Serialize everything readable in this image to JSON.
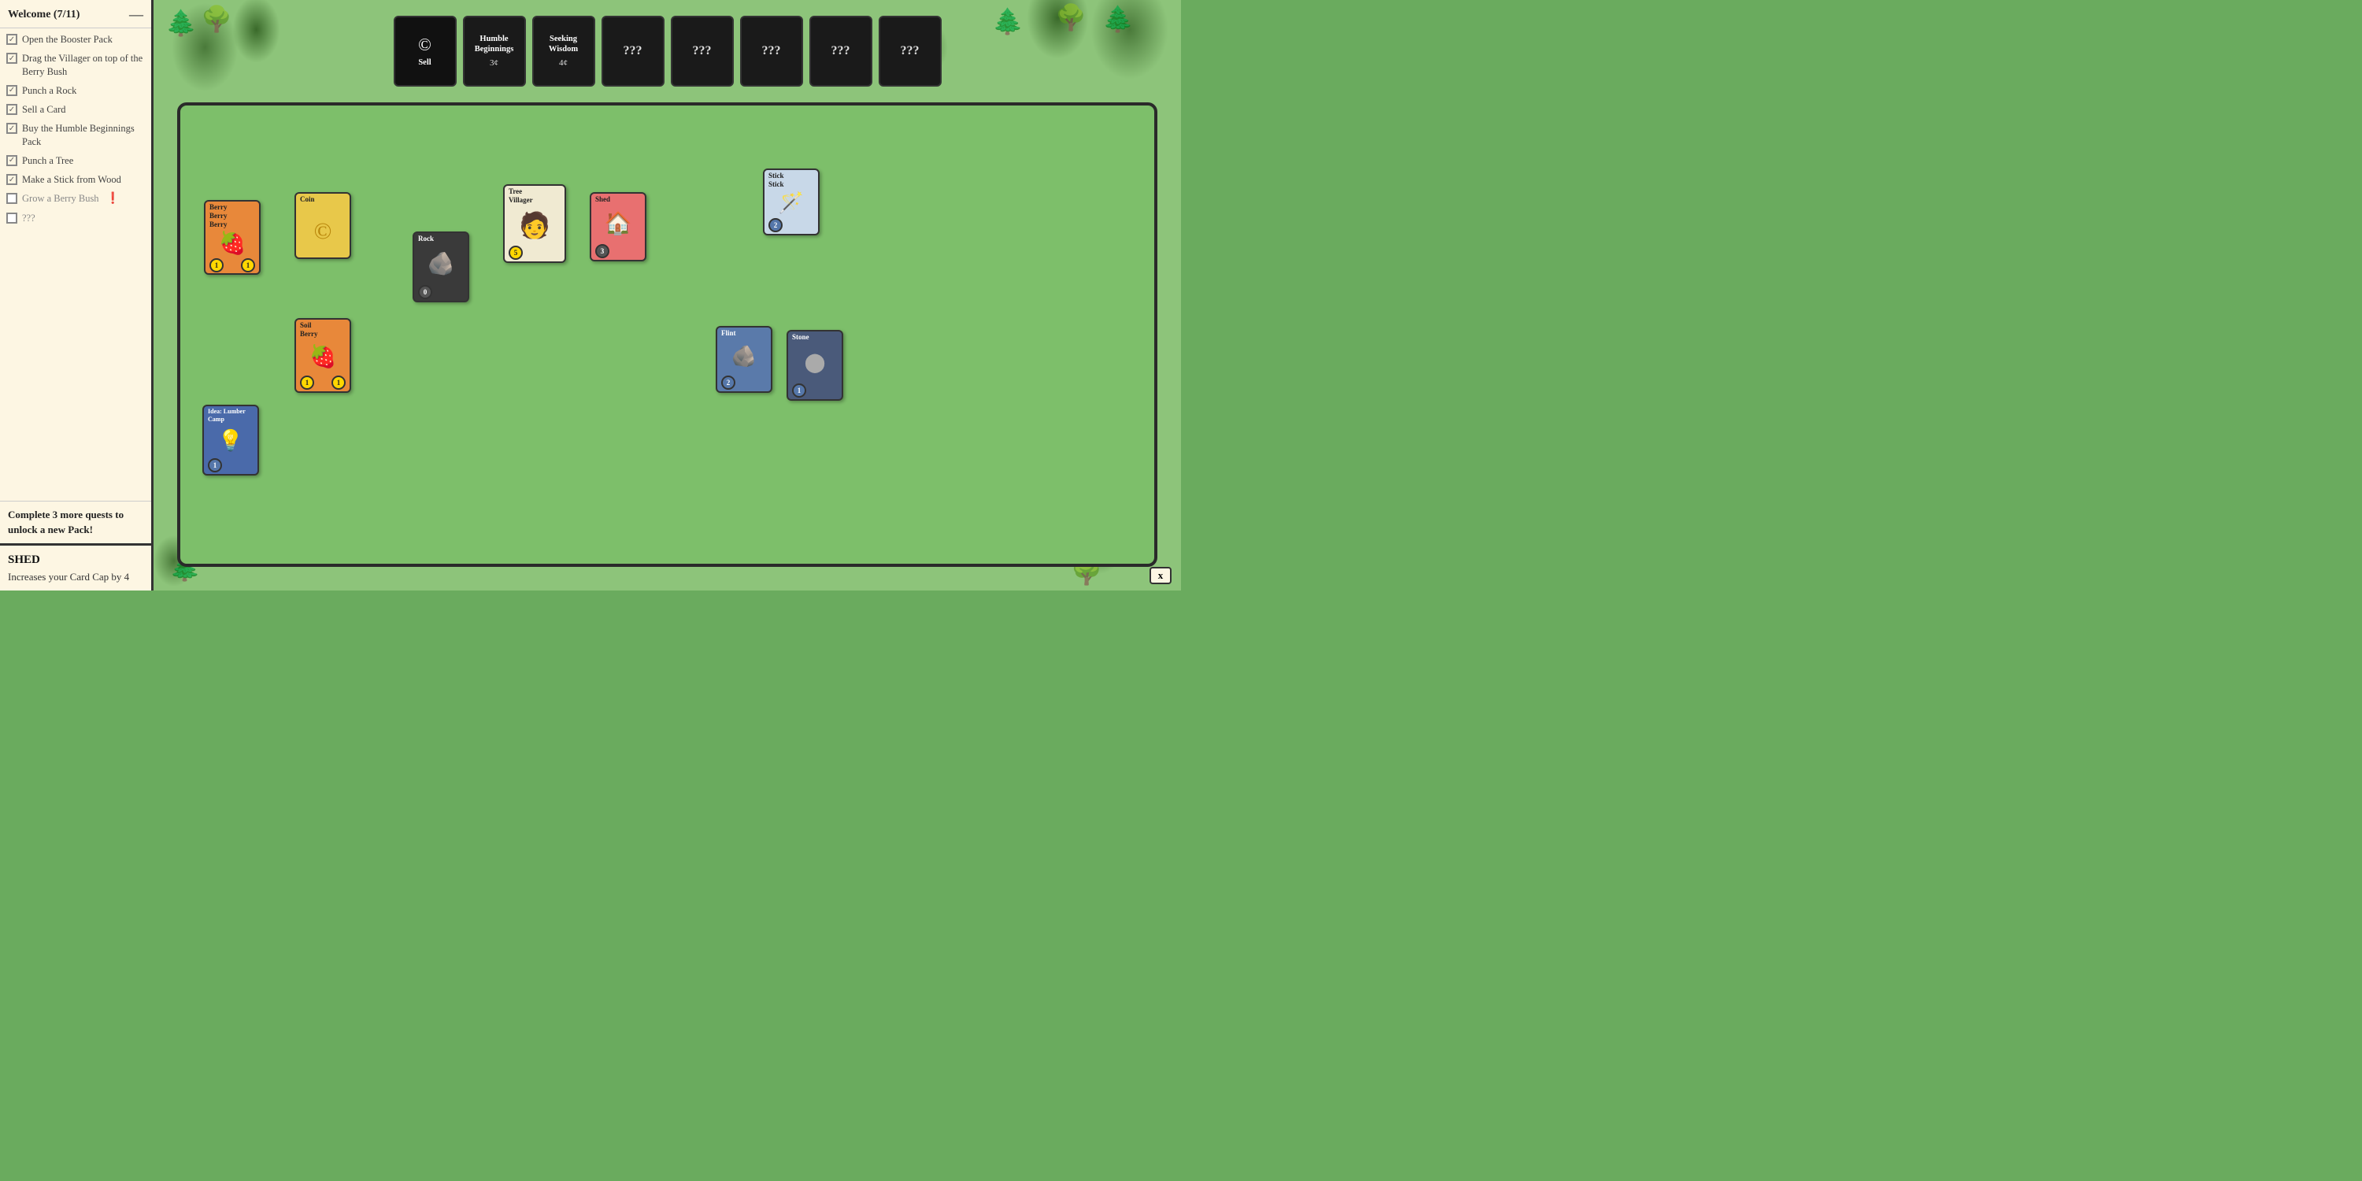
{
  "leftPanel": {
    "title": "Welcome (7/11)",
    "minimizeIcon": "—",
    "quests": [
      {
        "id": "open-booster",
        "label": "Open the Booster Pack",
        "completed": true
      },
      {
        "id": "drag-villager",
        "label": "Drag the Villager on top of the Berry Bush",
        "completed": true
      },
      {
        "id": "punch-rock",
        "label": "Punch a Rock",
        "completed": true
      },
      {
        "id": "sell-card",
        "label": "Sell a Card",
        "completed": true
      },
      {
        "id": "buy-humble",
        "label": "Buy the Humble Beginnings Pack",
        "completed": true
      },
      {
        "id": "punch-tree",
        "label": "Punch a Tree",
        "completed": true
      },
      {
        "id": "make-stick",
        "label": "Make a Stick from Wood",
        "completed": true
      },
      {
        "id": "grow-berry",
        "label": "Grow a Berry Bush",
        "completed": false,
        "alert": true
      },
      {
        "id": "unknown",
        "label": "???",
        "completed": false
      }
    ],
    "unlockText": "Complete 3 more quests to unlock a new Pack!",
    "shedInfo": {
      "title": "SHED",
      "description": "Increases your Card Cap by 4"
    }
  },
  "shopRow": {
    "sellCard": {
      "icon": "©",
      "label": "Sell"
    },
    "packs": [
      {
        "id": "humble",
        "name": "Humble Beginnings",
        "cost": "3"
      },
      {
        "id": "seeking",
        "name": "Seeking Wisdom",
        "cost": "4"
      },
      {
        "id": "unknown1",
        "name": "???",
        "cost": ""
      },
      {
        "id": "unknown2",
        "name": "???",
        "cost": ""
      },
      {
        "id": "unknown3",
        "name": "???",
        "cost": ""
      },
      {
        "id": "unknown4",
        "name": "???",
        "cost": ""
      },
      {
        "id": "unknown5",
        "name": "???",
        "cost": ""
      }
    ],
    "coinSymbol": "¢"
  },
  "boardCards": {
    "berry": {
      "header": "Berry\nBerry\nBerry",
      "icon": "🍓",
      "badge1": "1",
      "badge2": "1"
    },
    "coin": {
      "header": "Coin",
      "icon": "©",
      "badge": ""
    },
    "rock": {
      "header": "Rock",
      "icon": "🪨",
      "badge": "0"
    },
    "treeVillager": {
      "header1": "Tree",
      "header2": "Villager",
      "icon": "🧑",
      "badge": "5"
    },
    "shed": {
      "header": "Shed",
      "icon": "🏠",
      "badge": "3"
    },
    "stick": {
      "header1": "Stick",
      "header2": "Stick",
      "icon": "🪄",
      "badge": "2"
    },
    "flint": {
      "header": "Flint",
      "icon": "🪨",
      "badge": "2"
    },
    "stone": {
      "header": "Stone",
      "icon": "⬤",
      "badge": "1"
    },
    "soil": {
      "header1": "Soil",
      "header2": "Berry",
      "icon": "🍓",
      "badge1": "1",
      "badge2": "1"
    },
    "lumber": {
      "header": "Idea: Lumber Camp",
      "icon": "💡",
      "badge": "1"
    }
  },
  "xButton": "x"
}
